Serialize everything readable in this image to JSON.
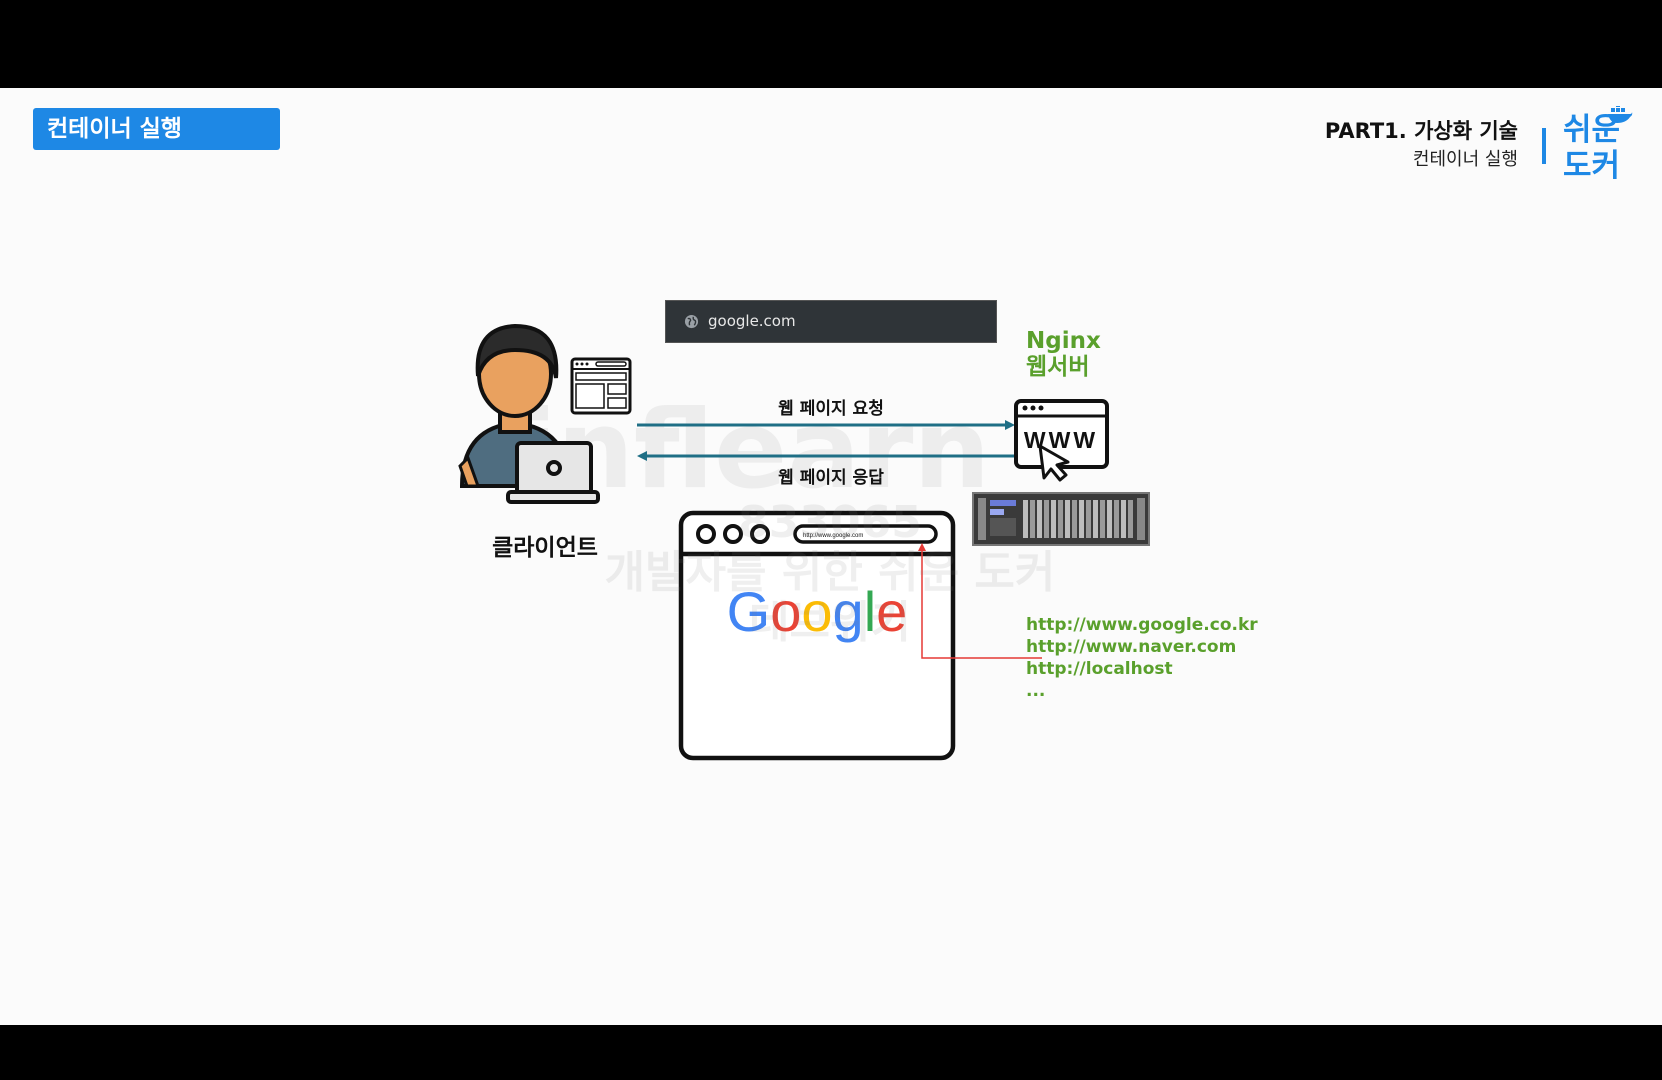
{
  "slide": {
    "title": "컨테이너 실행",
    "header_part": "PART1. 가상화 기술",
    "header_sub": "컨테이너 실행",
    "logo_line1": "쉬운",
    "logo_line2": "도커"
  },
  "diagram": {
    "address_bar": "google.com",
    "server_label_line1": "Nginx",
    "server_label_line2": "웹서버",
    "request_label": "웹 페이지 요청",
    "response_label": "웹 페이지 응답",
    "client_label": "클라이언트",
    "www_text": "WWW",
    "browser_url": "http://www.google.com",
    "google_logo": [
      "G",
      "o",
      "o",
      "g",
      "l",
      "e"
    ],
    "urls": [
      "http://www.google.co.kr",
      "http://www.naver.com",
      "http://localhost",
      "..."
    ]
  },
  "watermark": {
    "brand": "inflearn",
    "id": "833065",
    "line1": "개발자를 위한 쉬운 도커",
    "line2": "데브위키"
  },
  "colors": {
    "accent": "#1e88e5",
    "server_green": "#5aa02c",
    "arrow_teal": "#1f6f86",
    "pointer_red": "#e53935",
    "google_blue": "#4285F4",
    "google_red": "#EA4335",
    "google_yellow": "#FBBC05",
    "google_green": "#34A853"
  }
}
